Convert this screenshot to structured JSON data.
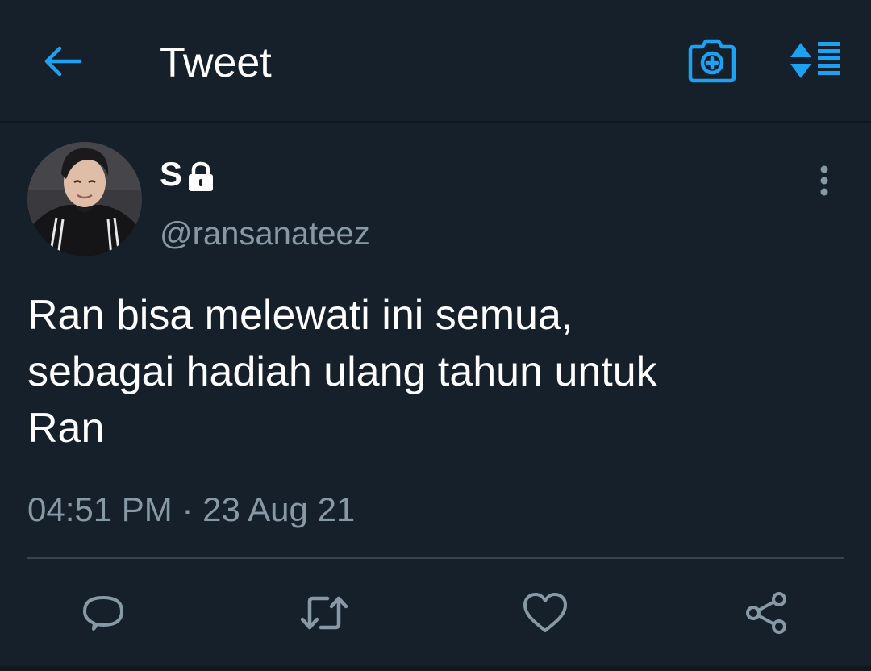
{
  "header": {
    "title": "Tweet",
    "back_icon": "arrow-left-icon",
    "camera_icon": "camera-add-icon",
    "sort_icon": "sort-lines-icon"
  },
  "tweet": {
    "author": {
      "display_name": "S",
      "handle": "@ransanateez",
      "protected": true
    },
    "text": "Ran bisa melewati ini semua,\nsebagai hadiah ulang tahun untuk\nRan",
    "timestamp": "04:51 PM · 23 Aug 21"
  },
  "actions": [
    "reply-icon",
    "retweet-icon",
    "like-icon",
    "share-icon"
  ],
  "colors": {
    "background": "#15202b",
    "accent": "#1da1f2",
    "secondary_text": "#8899a6",
    "divider": "#38444d"
  }
}
